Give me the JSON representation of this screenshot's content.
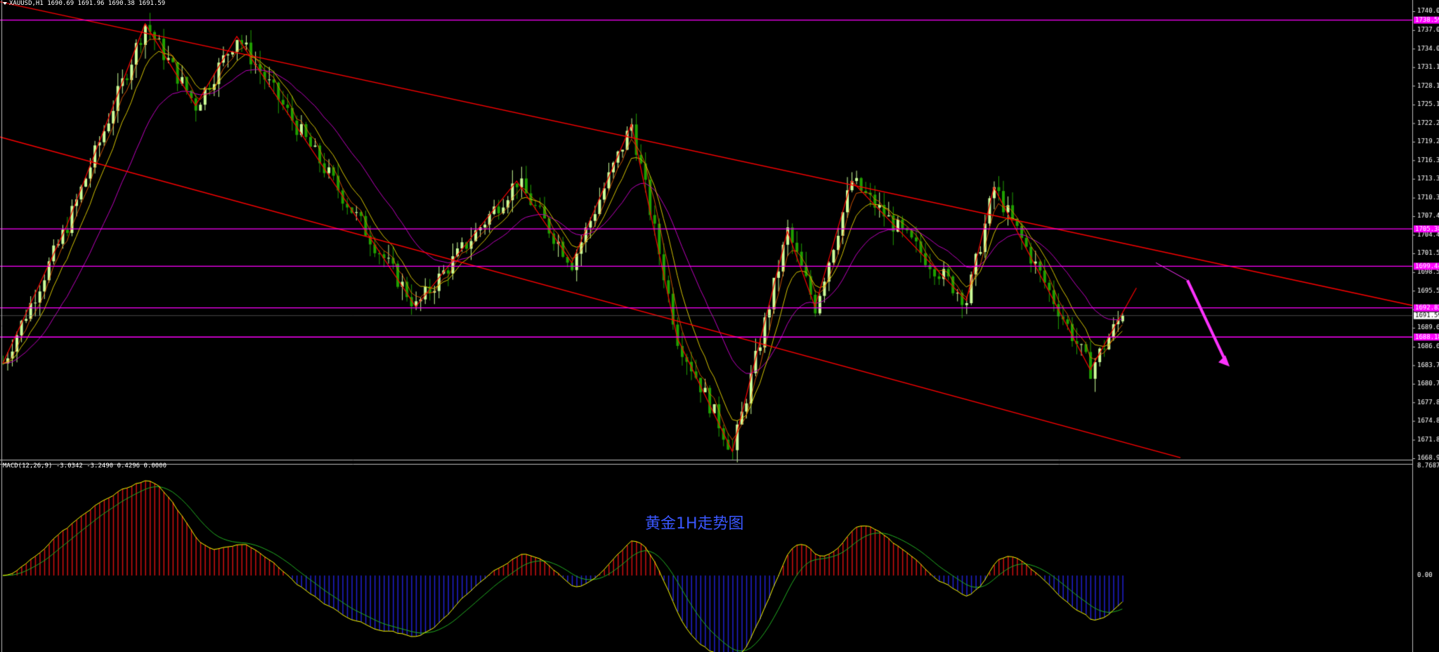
{
  "window": {
    "symbol_line": "XAUUSD,H1",
    "ohlc": "1690.69 1691.96 1690.38 1691.59"
  },
  "macd": {
    "label": "MACD(12,26,9)",
    "values": "-3.0342 -3.2490 0.4296 0.0000",
    "scale_top": "8.7687",
    "zero_label": "0.00"
  },
  "caption": "黄金1H走势图",
  "colors": {
    "background": "#000000",
    "bull_candle": "#ccff99",
    "bear_candle": "#1fa000",
    "trend": "#ff0000",
    "level": "#ff00ff",
    "arrow": "#ff33ff",
    "ma_fast": "#d6c400",
    "ma_slow": "#c000c0",
    "macd_line": "#ffff00",
    "signal_line": "#22b022",
    "hist_pos": "#d01010",
    "hist_neg": "#2020d0"
  },
  "price_axis": {
    "ticks": [
      "1740.00",
      "1737.00",
      "1734.05",
      "1731.10",
      "1728.15",
      "1725.15",
      "1722.20",
      "1719.25",
      "1716.30",
      "1713.35",
      "1710.35",
      "1707.40",
      "1704.45",
      "1701.50",
      "1698.50",
      "1695.55",
      "1692.60",
      "1689.65",
      "1686.65",
      "1683.70",
      "1680.75",
      "1677.80",
      "1674.85",
      "1671.85",
      "1668.90"
    ],
    "level_labels": [
      "1738.59",
      "1705.38",
      "1699.44",
      "1692.82",
      "1688.18"
    ],
    "current": "1691.59"
  },
  "chart_data": {
    "type": "candlestick",
    "symbol": "XAUUSD",
    "timeframe": "H1",
    "last_ohlc": {
      "open": 1690.69,
      "high": 1691.96,
      "low": 1690.38,
      "close": 1691.59
    },
    "y_range": [
      1668.9,
      1740.0
    ],
    "horizontal_levels": [
      1738.59,
      1705.38,
      1699.44,
      1692.82,
      1688.18
    ],
    "current_price": 1691.59,
    "price_swings": [
      {
        "bar": 0,
        "price": 1684
      },
      {
        "bar": 14,
        "price": 1706
      },
      {
        "bar": 31,
        "price": 1738
      },
      {
        "bar": 42,
        "price": 1725
      },
      {
        "bar": 51,
        "price": 1736
      },
      {
        "bar": 90,
        "price": 1693
      },
      {
        "bar": 112,
        "price": 1713
      },
      {
        "bar": 124,
        "price": 1700
      },
      {
        "bar": 137,
        "price": 1722
      },
      {
        "bar": 147,
        "price": 1688
      },
      {
        "bar": 159,
        "price": 1670
      },
      {
        "bar": 171,
        "price": 1705
      },
      {
        "bar": 177,
        "price": 1693
      },
      {
        "bar": 185,
        "price": 1713
      },
      {
        "bar": 210,
        "price": 1694
      },
      {
        "bar": 216,
        "price": 1712
      },
      {
        "bar": 237,
        "price": 1683
      },
      {
        "bar": 244,
        "price": 1692
      }
    ],
    "macd": {
      "fast": 12,
      "slow": 26,
      "signal": 9,
      "main": -3.0342,
      "signal_value": -3.249,
      "histogram": 0.4296,
      "extra": 0.0,
      "scale_max": 8.7687
    }
  }
}
